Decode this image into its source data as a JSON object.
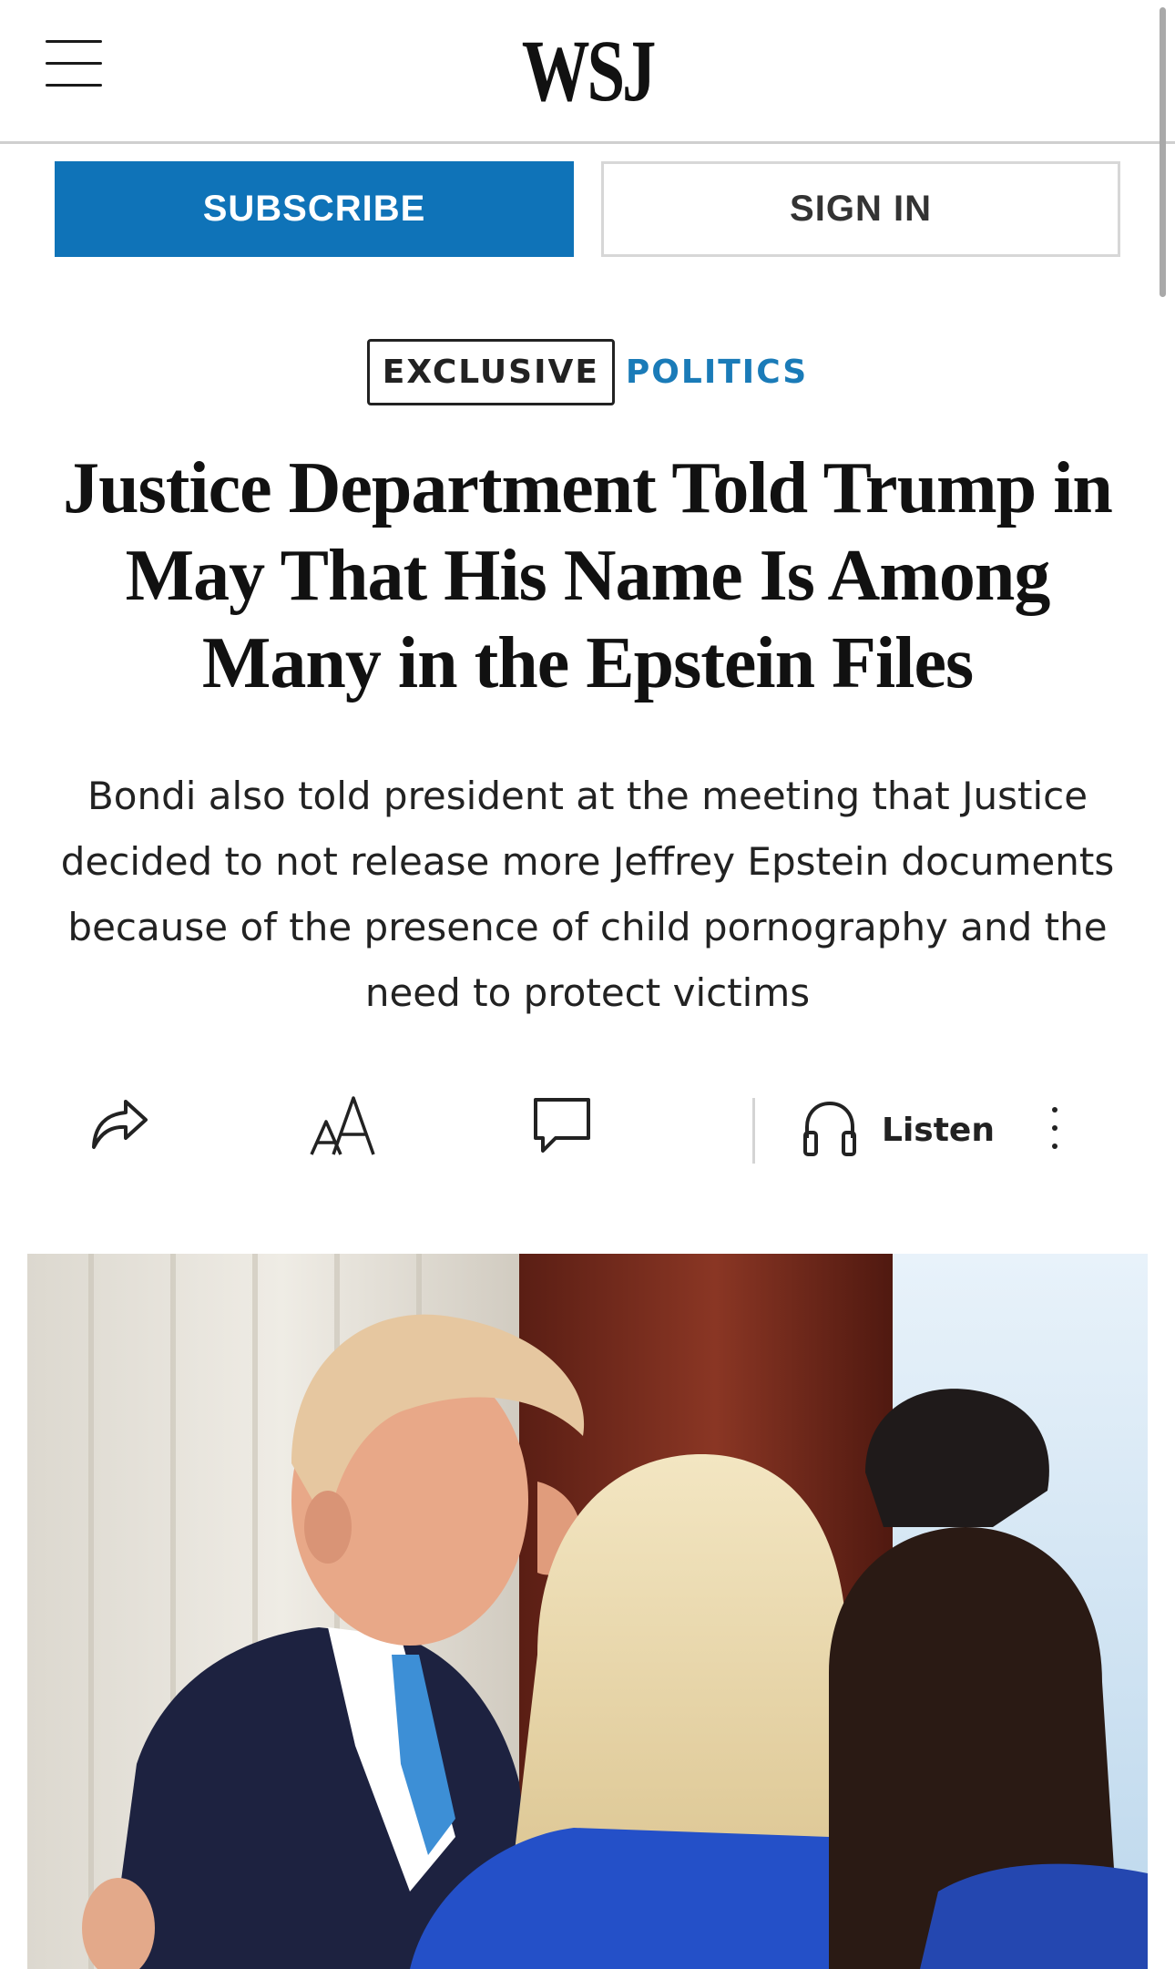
{
  "header": {
    "logo": "WSJ",
    "menu_icon": "hamburger-menu-icon"
  },
  "auth": {
    "subscribe_label": "SUBSCRIBE",
    "signin_label": "SIGN IN"
  },
  "article": {
    "tag": "EXCLUSIVE",
    "section": "POLITICS",
    "headline": "Justice Department Told Trump in May That His Name Is Among Many in the Epstein Files",
    "dek": "Bondi also told president at the meeting that Justice decided to not release more Jeffrey Epstein documents because of the presence of child pornography and the need to protect victims"
  },
  "toolbar": {
    "share_icon": "share-icon",
    "text_size_icon": "text-size-icon",
    "comment_icon": "comment-icon",
    "listen_icon": "headphones-icon",
    "listen_label": "Listen",
    "more_icon": "more-vertical-icon"
  },
  "colors": {
    "subscribe_bg": "#0f73b8",
    "section_link": "#1a7bb8",
    "text": "#111111"
  }
}
